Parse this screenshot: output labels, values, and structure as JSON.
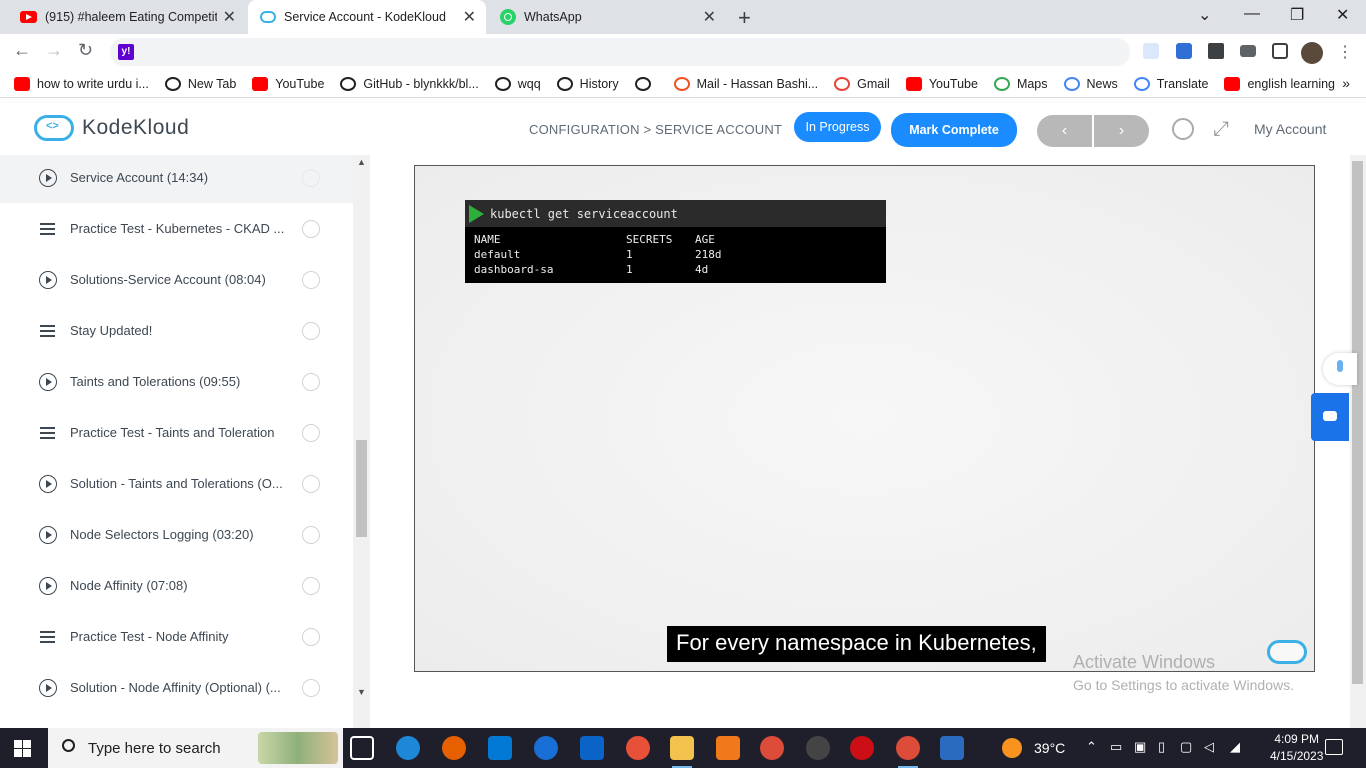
{
  "browser": {
    "tabs": [
      {
        "title": "(915) #haleem Eating Competitio",
        "icon": "youtube-icon"
      },
      {
        "title": "Service Account - KodeKloud",
        "icon": "kodekloud-icon"
      },
      {
        "title": "WhatsApp",
        "icon": "whatsapp-icon"
      }
    ],
    "bookmarks": [
      {
        "label": "how to write urdu i...",
        "icon": "youtube-icon",
        "color": "#ff0000"
      },
      {
        "label": "New Tab",
        "icon": "globe-icon",
        "color": "#202124"
      },
      {
        "label": "YouTube",
        "icon": "youtube-icon",
        "color": "#ff0000"
      },
      {
        "label": "GitHub - blynkkk/bl...",
        "icon": "github-icon",
        "color": "#202124"
      },
      {
        "label": "wqq",
        "icon": "download-icon",
        "color": "#202124"
      },
      {
        "label": "History",
        "icon": "history-icon",
        "color": "#202124"
      },
      {
        "label": "",
        "icon": "globe-icon",
        "color": "#202124"
      },
      {
        "label": "Mail - Hassan Bashi...",
        "icon": "microsoft-icon",
        "color": "#f25022"
      },
      {
        "label": "Gmail",
        "icon": "gmail-icon",
        "color": "#ea4335"
      },
      {
        "label": "YouTube",
        "icon": "youtube-icon",
        "color": "#ff0000"
      },
      {
        "label": "Maps",
        "icon": "maps-icon",
        "color": "#34a853"
      },
      {
        "label": "News",
        "icon": "news-icon",
        "color": "#4285f4"
      },
      {
        "label": "Translate",
        "icon": "translate-icon",
        "color": "#4285f4"
      },
      {
        "label": "english learning",
        "icon": "youtube-icon",
        "color": "#ff0000"
      }
    ]
  },
  "header": {
    "brand": "KodeKloud",
    "breadcrumb": "CONFIGURATION > SERVICE ACCOUNT",
    "status_label": "In Progress",
    "mark_complete_label": "Mark Complete",
    "account_label": "My Account",
    "accent_color": "#1a8cff"
  },
  "sidebar": {
    "lessons": [
      {
        "title": "Service Account (14:34)",
        "type": "video",
        "active": true
      },
      {
        "title": "Practice Test - Kubernetes - CKAD ...",
        "type": "doc"
      },
      {
        "title": "Solutions-Service Account (08:04)",
        "type": "video"
      },
      {
        "title": "Stay Updated!",
        "type": "doc"
      },
      {
        "title": "Taints and Tolerations (09:55)",
        "type": "video"
      },
      {
        "title": "Practice Test - Taints and Toleration",
        "type": "doc"
      },
      {
        "title": "Solution - Taints and Tolerations (O...",
        "type": "video"
      },
      {
        "title": "Node Selectors Logging (03:20)",
        "type": "video"
      },
      {
        "title": "Node Affinity (07:08)",
        "type": "video"
      },
      {
        "title": "Practice Test - Node Affinity",
        "type": "doc"
      },
      {
        "title": "Solution - Node Affinity (Optional) (...",
        "type": "video"
      }
    ]
  },
  "video": {
    "command": "kubectl get serviceaccount",
    "columns": [
      "NAME",
      "SECRETS",
      "AGE"
    ],
    "rows": [
      [
        "default",
        "1",
        "218d"
      ],
      [
        "dashboard-sa",
        "1",
        "4d"
      ]
    ],
    "caption": "For every namespace in Kubernetes,"
  },
  "watermark": {
    "line1": "Activate Windows",
    "line2": "Go to Settings to activate Windows."
  },
  "taskbar": {
    "search_placeholder": "Type here to search",
    "temperature": "39°C",
    "time": "4:09 PM",
    "date": "4/15/2023",
    "notification_count": "1"
  }
}
